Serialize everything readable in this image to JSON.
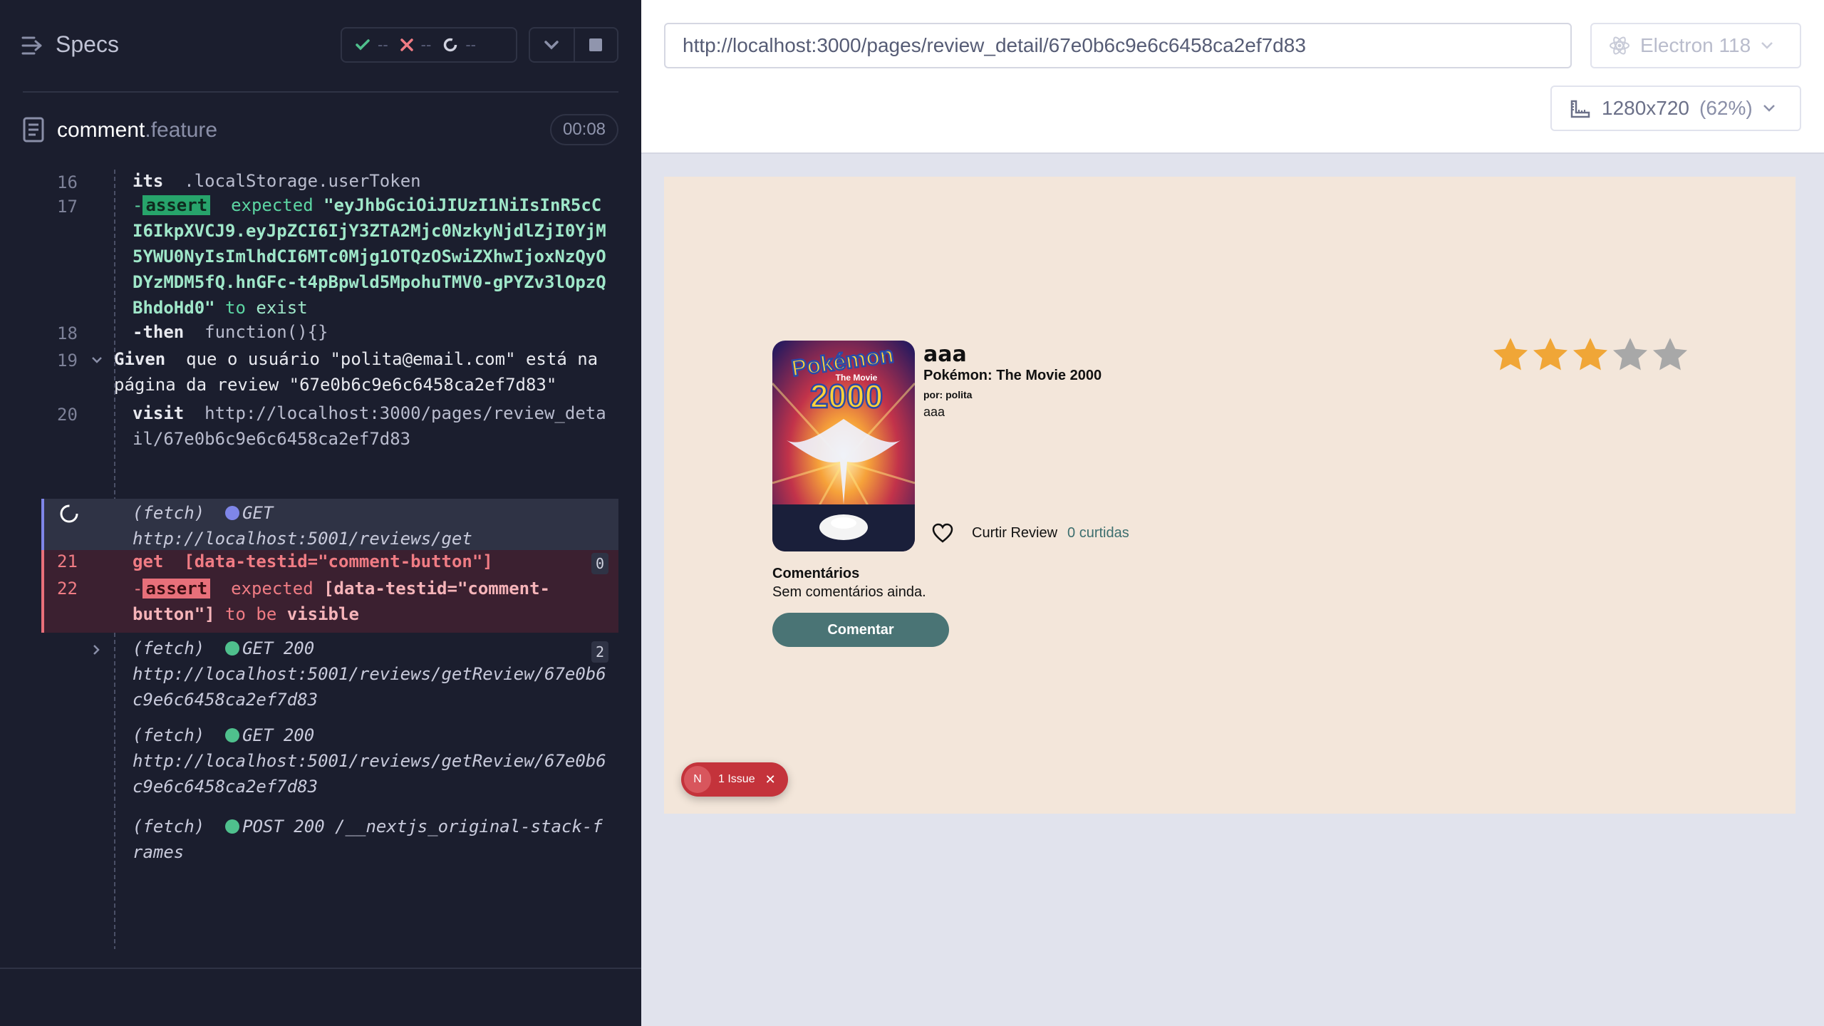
{
  "runner": {
    "specs_label": "Specs",
    "stats": {
      "passed": "--",
      "failed": "--",
      "pending": "--"
    },
    "spec_file": {
      "name": "comment",
      "ext": ".feature",
      "duration": "00:08"
    }
  },
  "log": {
    "r16": {
      "num": "16",
      "cmd": "its",
      "arg": ".localStorage.userToken"
    },
    "r17": {
      "num": "17",
      "prefix": "-",
      "badge": "assert",
      "word1": "expected",
      "value": "\"eyJhbGciOiJIUzI1NiIsInR5cCI6IkpXVCJ9.eyJpZCI6IjY3ZTA2Mjc0NzkyNjdlZjI0YjM5YWU0NyIsImlhdCI6MTc0Mjg1OTQzOSwiZXhwIjoxNzQyODYzMDM5fQ.hnGFc-t4pBpwld5MpohuTMV0-gPYZv3lOpzQBhdoHd0\"",
      "word2": "to",
      "word3": "exist"
    },
    "r18": {
      "num": "18",
      "prefix": "-",
      "cmd": "then",
      "arg": "function(){}"
    },
    "r19": {
      "num": "19",
      "keyword": "Given",
      "text": "que o usuário \"polita@email.com\" está na página da review \"67e0b6c9e6c6458ca2ef7d83\""
    },
    "r20": {
      "num": "20",
      "cmd": "visit",
      "arg": "http://localhost:3000/pages/review_detail/67e0b6c9e6c6458ca2ef7d83"
    },
    "rfetch1": {
      "label": "(fetch)",
      "method": "GET",
      "url": "http://localhost:5001/reviews/get"
    },
    "r21": {
      "num": "21",
      "cmd": "get",
      "arg": "[data-testid=\"comment-button\"]",
      "count": "0"
    },
    "r22": {
      "num": "22",
      "prefix": "-",
      "badge": "assert",
      "word1": "expected",
      "arg": "[data-testid=\"comment-button\"]",
      "word2": "to be",
      "word3": "visible"
    },
    "rfetch2": {
      "label": "(fetch)",
      "method": "GET 200",
      "url": "http://localhost:5001/reviews/getReview/67e0b6c9e6c6458ca2ef7d83",
      "count": "2"
    },
    "rfetch3": {
      "label": "(fetch)",
      "method": "GET 200",
      "url": "http://localhost:5001/reviews/getReview/67e0b6c9e6c6458ca2ef7d83"
    },
    "rfetch4": {
      "label": "(fetch)",
      "method": "POST 200",
      "url": "/__nextjs_original-stack-frames"
    }
  },
  "browser_bar": {
    "url": "http://localhost:3000/pages/review_detail/67e0b6c9e6c6458ca2ef7d83",
    "browser": "Electron 118",
    "viewport": "1280x720",
    "zoom": "(62%)"
  },
  "app": {
    "poster": {
      "brand": "Pokémon",
      "subtitle": "The Movie",
      "year": "2000"
    },
    "review_user": "aaa",
    "movie_title": "Pokémon: The Movie 2000",
    "by_user": "por: polita",
    "review_text": "aaa",
    "rating": 3,
    "rating_max": 5,
    "like_label": "Curtir Review",
    "like_count": "0 curtidas",
    "comments_title": "Comentários",
    "comments_empty": "Sem comentários ainda.",
    "comment_button": "Comentar",
    "issue": {
      "initial": "N",
      "label": "1 Issue"
    }
  },
  "colors": {
    "runner_bg": "#1b1e2e",
    "aut_bg": "#f3e6da",
    "accent_teal": "#4a7475",
    "star_filled": "#f0a637",
    "star_empty": "#a8a8a8",
    "issue_red": "#c4333b"
  }
}
